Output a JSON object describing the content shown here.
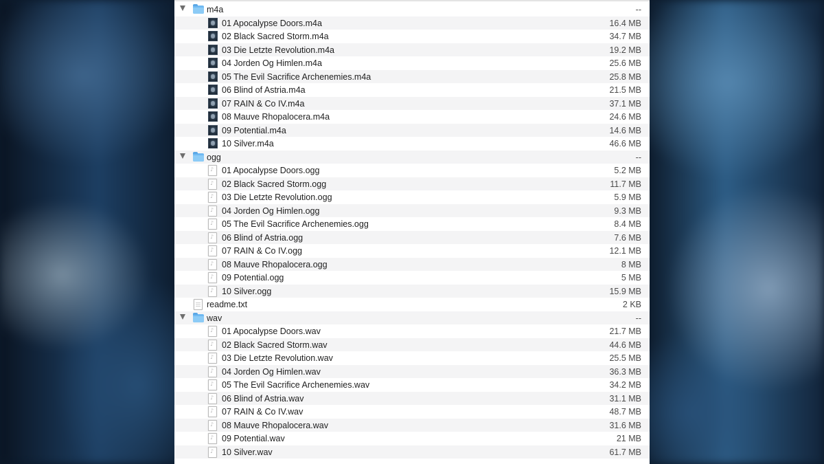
{
  "items": [
    {
      "kind": "folder",
      "name": "m4a",
      "size": "--"
    },
    {
      "kind": "m4a",
      "name": "01 Apocalypse Doors.m4a",
      "size": "16.4 MB"
    },
    {
      "kind": "m4a",
      "name": "02 Black Sacred Storm.m4a",
      "size": "34.7 MB"
    },
    {
      "kind": "m4a",
      "name": "03 Die Letzte Revolution.m4a",
      "size": "19.2 MB"
    },
    {
      "kind": "m4a",
      "name": "04 Jorden Og Himlen.m4a",
      "size": "25.6 MB"
    },
    {
      "kind": "m4a",
      "name": "05 The Evil Sacrifice Archenemies.m4a",
      "size": "25.8 MB"
    },
    {
      "kind": "m4a",
      "name": "06 Blind of Astria.m4a",
      "size": "21.5 MB"
    },
    {
      "kind": "m4a",
      "name": "07 RAIN & Co IV.m4a",
      "size": "37.1 MB"
    },
    {
      "kind": "m4a",
      "name": "08 Mauve Rhopalocera.m4a",
      "size": "24.6 MB"
    },
    {
      "kind": "m4a",
      "name": "09 Potential.m4a",
      "size": "14.6 MB"
    },
    {
      "kind": "m4a",
      "name": "10 Silver.m4a",
      "size": "46.6 MB"
    },
    {
      "kind": "folder",
      "name": "ogg",
      "size": "--"
    },
    {
      "kind": "audio",
      "name": "01 Apocalypse Doors.ogg",
      "size": "5.2 MB"
    },
    {
      "kind": "audio",
      "name": "02 Black Sacred Storm.ogg",
      "size": "11.7 MB"
    },
    {
      "kind": "audio",
      "name": "03 Die Letzte Revolution.ogg",
      "size": "5.9 MB"
    },
    {
      "kind": "audio",
      "name": "04 Jorden Og Himlen.ogg",
      "size": "9.3 MB"
    },
    {
      "kind": "audio",
      "name": "05 The Evil Sacrifice Archenemies.ogg",
      "size": "8.4 MB"
    },
    {
      "kind": "audio",
      "name": "06 Blind of Astria.ogg",
      "size": "7.6 MB"
    },
    {
      "kind": "audio",
      "name": "07 RAIN & Co IV.ogg",
      "size": "12.1 MB"
    },
    {
      "kind": "audio",
      "name": "08 Mauve Rhopalocera.ogg",
      "size": "8 MB"
    },
    {
      "kind": "audio",
      "name": "09 Potential.ogg",
      "size": "5 MB"
    },
    {
      "kind": "audio",
      "name": "10 Silver.ogg",
      "size": "15.9 MB"
    },
    {
      "kind": "text",
      "name": "readme.txt",
      "size": "2 KB"
    },
    {
      "kind": "folder",
      "name": "wav",
      "size": "--"
    },
    {
      "kind": "audio",
      "name": "01 Apocalypse Doors.wav",
      "size": "21.7 MB"
    },
    {
      "kind": "audio",
      "name": "02 Black Sacred Storm.wav",
      "size": "44.6 MB"
    },
    {
      "kind": "audio",
      "name": "03 Die Letzte Revolution.wav",
      "size": "25.5 MB"
    },
    {
      "kind": "audio",
      "name": "04 Jorden Og Himlen.wav",
      "size": "36.3 MB"
    },
    {
      "kind": "audio",
      "name": "05 The Evil Sacrifice Archenemies.wav",
      "size": "34.2 MB"
    },
    {
      "kind": "audio",
      "name": "06 Blind of Astria.wav",
      "size": "31.1 MB"
    },
    {
      "kind": "audio",
      "name": "07 RAIN & Co IV.wav",
      "size": "48.7 MB"
    },
    {
      "kind": "audio",
      "name": "08 Mauve Rhopalocera.wav",
      "size": "31.6 MB"
    },
    {
      "kind": "audio",
      "name": "09 Potential.wav",
      "size": "21 MB"
    },
    {
      "kind": "audio",
      "name": "10 Silver.wav",
      "size": "61.7 MB"
    }
  ],
  "icons": {
    "folder": "folder-icon",
    "m4a": "m4a-file-icon",
    "audio": "audio-file-icon",
    "text": "text-file-icon",
    "disclosure": "disclosure-triangle-icon"
  },
  "colors": {
    "folder": "#6fb9f2",
    "alt_row": "#f4f4f5",
    "text": "#1e1e1e"
  }
}
